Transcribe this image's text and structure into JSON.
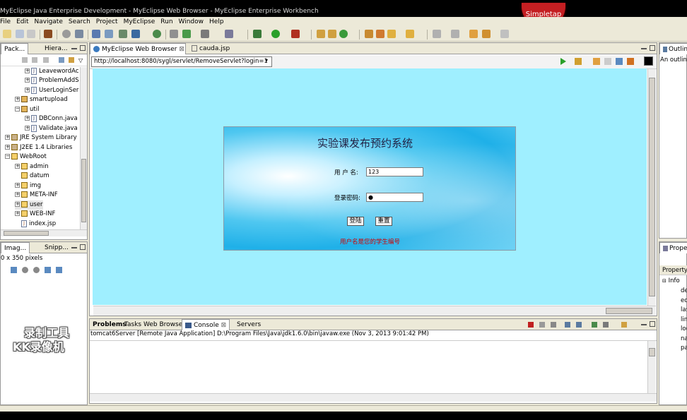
{
  "window": {
    "title": "MyEclipse Java Enterprise Development - MyEclipse Web Browser - MyEclipse Enterprise Workbench",
    "badge": "Simpletap"
  },
  "menu": [
    "File",
    "Edit",
    "Navigate",
    "Search",
    "Project",
    "MyEclipse",
    "Run",
    "Window",
    "Help"
  ],
  "package_explorer": {
    "tabs": [
      "Pack...",
      "Hiera..."
    ],
    "items": [
      {
        "label": "LeavewordAc",
        "kind": "java"
      },
      {
        "label": "ProblemAddS",
        "kind": "java"
      },
      {
        "label": "UserLoginSer",
        "kind": "java"
      },
      {
        "label": "smartupload",
        "kind": "package"
      },
      {
        "label": "util",
        "kind": "package"
      },
      {
        "label": "DBConn.java",
        "kind": "java"
      },
      {
        "label": "Validate.java",
        "kind": "java"
      },
      {
        "label": "JRE System Library",
        "kind": "lib"
      },
      {
        "label": "J2EE 1.4 Libraries",
        "kind": "lib"
      },
      {
        "label": "WebRoot",
        "kind": "folder"
      },
      {
        "label": "admin",
        "kind": "folder"
      },
      {
        "label": "datum",
        "kind": "folder"
      },
      {
        "label": "img",
        "kind": "folder"
      },
      {
        "label": "META-INF",
        "kind": "folder"
      },
      {
        "label": "user",
        "kind": "folder"
      },
      {
        "label": "WEB-INF",
        "kind": "folder"
      },
      {
        "label": "index.jsp",
        "kind": "jsp"
      }
    ]
  },
  "image_panel": {
    "tabs": [
      "Imag...",
      "Snipp..."
    ],
    "info": "0 x 350 pixels"
  },
  "watermark": {
    "line1": "录制工具",
    "line2": "KK录像机"
  },
  "editor": {
    "tabs": [
      "MyEclipse Web Browser",
      "cauda.jsp"
    ],
    "url": "http://localhost:8080/sygl/servlet/RemoveServlet?login=1"
  },
  "login_page": {
    "title": "实验课发布预约系统",
    "username_label": "用 户 名:",
    "username_value": "123",
    "password_label": "登录密码:",
    "password_value": "●",
    "login_button": "登陆",
    "reset_button": "重置",
    "hint": "用户名是您的学生编号"
  },
  "console": {
    "tabs": [
      "Problems",
      "Tasks",
      "Web Browser",
      "Console",
      "Servers"
    ],
    "process": "tomcat6Server [Remote Java Application] D:\\Program Files\\Java\\jdk1.6.0\\bin\\javaw.exe (Nov 3, 2013 9:01:42 PM)"
  },
  "outline": {
    "tab": "Outline",
    "text": "An outline"
  },
  "properties": {
    "tab": "Prope",
    "header": "Property",
    "group": "Info",
    "rows": [
      "de",
      "ed",
      "las",
      "lin",
      "loc",
      "na",
      "pa"
    ]
  },
  "colors": {
    "browser_bg": "#9fefff",
    "hint_red": "#d00000",
    "chrome": "#ece9d8"
  }
}
